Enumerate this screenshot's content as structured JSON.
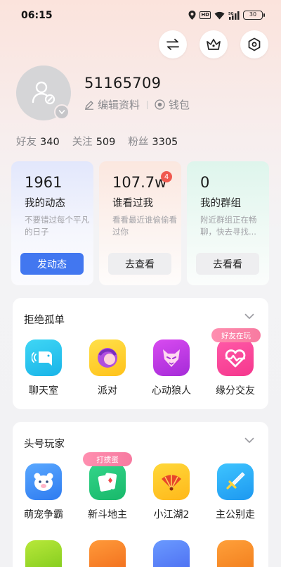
{
  "status_bar": {
    "time": "06:15",
    "network": "5G",
    "battery": "30"
  },
  "header": {
    "buttons": [
      {
        "icon": "switch-icon"
      },
      {
        "icon": "crown-icon"
      },
      {
        "icon": "settings-icon"
      }
    ]
  },
  "profile": {
    "user_id": "51165709",
    "edit_label": "编辑资料",
    "wallet_label": "钱包"
  },
  "stats": [
    {
      "label": "好友",
      "value": "340"
    },
    {
      "label": "关注",
      "value": "509"
    },
    {
      "label": "粉丝",
      "value": "3305"
    }
  ],
  "cards": [
    {
      "number": "1961",
      "title": "我的动态",
      "desc": "不要错过每个平凡的日子",
      "button": "发动态"
    },
    {
      "number": "107.7w",
      "badge": "4",
      "title": "谁看过我",
      "desc": "看看最近谁偷偷看过你",
      "button": "去查看"
    },
    {
      "number": "0",
      "title": "我的群组",
      "desc": "附近群组正在畅聊，快去寻找...",
      "button": "去看看"
    }
  ],
  "section1": {
    "title": "拒绝孤单",
    "apps": [
      {
        "label": "聊天室",
        "icon": "chat-room-icon"
      },
      {
        "label": "派对",
        "icon": "party-icon"
      },
      {
        "label": "心动狼人",
        "icon": "wolf-icon"
      },
      {
        "label": "缘分交友",
        "icon": "heart-match-icon",
        "tag": "好友在玩"
      }
    ]
  },
  "section2": {
    "title": "头号玩家",
    "apps": [
      {
        "label": "萌宠争霸",
        "icon": "bear-icon"
      },
      {
        "label": "新斗地主",
        "icon": "cards-icon",
        "tag": "打掼蛋"
      },
      {
        "label": "小江湖2",
        "icon": "fan-icon"
      },
      {
        "label": "主公别走",
        "icon": "sword-icon"
      }
    ]
  },
  "colors": {
    "accent": "#4277f0",
    "badge": "#f0594f",
    "pill": "#f77aa0"
  }
}
